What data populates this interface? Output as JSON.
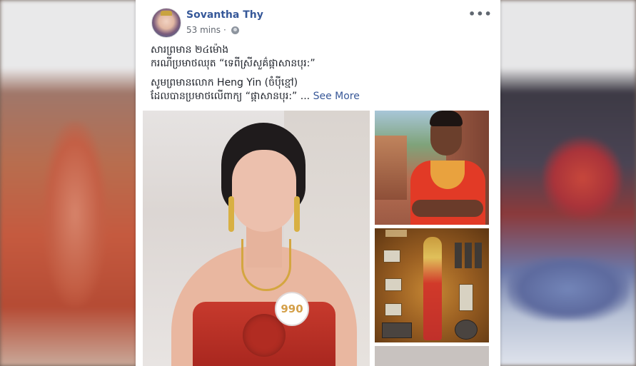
{
  "post": {
    "author": "Sovantha Thy",
    "time": "53 mins",
    "separator": "·",
    "more_label": "•••",
    "lines": [
      "សារព្រមាន ២៤ម៉ោង",
      "ករណីប្រមាថឈុត “ទេពីស្រីសួគ៌ផ្កាសានបុរ:”",
      "សូមព្រមានលោក Heng Yin (ចំប៉ីខ្មៅ)",
      "ដែលបានប្រមាថលើពាក្យ “ផ្កាសានបុរ:” ..."
    ],
    "see_more": "See More"
  },
  "photos": {
    "badge": "990"
  },
  "icons": {
    "privacy": "globe-icon",
    "options": "more-options-icon"
  }
}
